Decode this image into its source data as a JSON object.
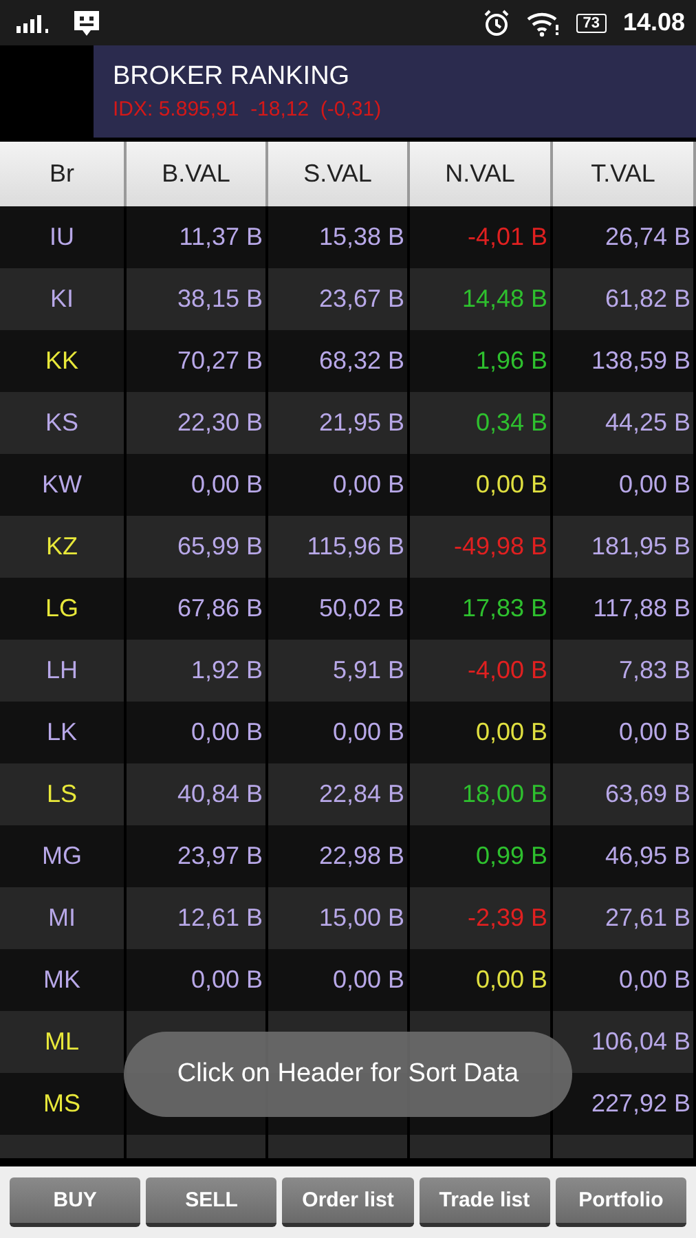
{
  "status_bar": {
    "battery": "73",
    "time": "14.08"
  },
  "header": {
    "title": "BROKER RANKING",
    "index": "IDX: 5.895,91  -18,12  (-0,31)"
  },
  "table": {
    "columns": [
      "Br",
      "B.VAL",
      "S.VAL",
      "N.VAL",
      "T.VAL"
    ],
    "rows": [
      {
        "code": "IU",
        "color": "#b8a8e8",
        "b": "11,37 B",
        "s": "15,38 B",
        "net": {
          "text": "-4,01 B",
          "color": "#e02020"
        },
        "t": "26,74 B"
      },
      {
        "code": "KI",
        "color": "#b8a8e8",
        "b": "38,15 B",
        "s": "23,67 B",
        "net": {
          "text": "14,48 B",
          "color": "#2ec02e"
        },
        "t": "61,82 B"
      },
      {
        "code": "KK",
        "color": "#e8e83a",
        "b": "70,27 B",
        "s": "68,32 B",
        "net": {
          "text": "1,96 B",
          "color": "#2ec02e"
        },
        "t": "138,59 B"
      },
      {
        "code": "KS",
        "color": "#b8a8e8",
        "b": "22,30 B",
        "s": "21,95 B",
        "net": {
          "text": "0,34 B",
          "color": "#2ec02e"
        },
        "t": "44,25 B"
      },
      {
        "code": "KW",
        "color": "#b8a8e8",
        "b": "0,00 B",
        "s": "0,00 B",
        "net": {
          "text": "0,00 B",
          "color": "#e0e040"
        },
        "t": "0,00 B"
      },
      {
        "code": "KZ",
        "color": "#e8e83a",
        "b": "65,99 B",
        "s": "115,96 B",
        "net": {
          "text": "-49,98 B",
          "color": "#e02020"
        },
        "t": "181,95 B"
      },
      {
        "code": "LG",
        "color": "#e8e83a",
        "b": "67,86 B",
        "s": "50,02 B",
        "net": {
          "text": "17,83 B",
          "color": "#2ec02e"
        },
        "t": "117,88 B"
      },
      {
        "code": "LH",
        "color": "#b8a8e8",
        "b": "1,92 B",
        "s": "5,91 B",
        "net": {
          "text": "-4,00 B",
          "color": "#e02020"
        },
        "t": "7,83 B"
      },
      {
        "code": "LK",
        "color": "#b8a8e8",
        "b": "0,00 B",
        "s": "0,00 B",
        "net": {
          "text": "0,00 B",
          "color": "#e0e040"
        },
        "t": "0,00 B"
      },
      {
        "code": "LS",
        "color": "#e8e83a",
        "b": "40,84 B",
        "s": "22,84 B",
        "net": {
          "text": "18,00 B",
          "color": "#2ec02e"
        },
        "t": "63,69 B"
      },
      {
        "code": "MG",
        "color": "#b8a8e8",
        "b": "23,97 B",
        "s": "22,98 B",
        "net": {
          "text": "0,99 B",
          "color": "#2ec02e"
        },
        "t": "46,95 B"
      },
      {
        "code": "MI",
        "color": "#b8a8e8",
        "b": "12,61 B",
        "s": "15,00 B",
        "net": {
          "text": "-2,39 B",
          "color": "#e02020"
        },
        "t": "27,61 B"
      },
      {
        "code": "MK",
        "color": "#b8a8e8",
        "b": "0,00 B",
        "s": "0,00 B",
        "net": {
          "text": "0,00 B",
          "color": "#e0e040"
        },
        "t": "0,00 B"
      },
      {
        "code": "ML",
        "color": "#e8e83a",
        "t": "106,04 B"
      },
      {
        "code": "MS",
        "color": "#e8e83a",
        "t": "227,92 B"
      }
    ]
  },
  "toast": "Click on Header for Sort Data",
  "buttons": [
    "BUY",
    "SELL",
    "Order list",
    "Trade list",
    "Portfolio"
  ]
}
